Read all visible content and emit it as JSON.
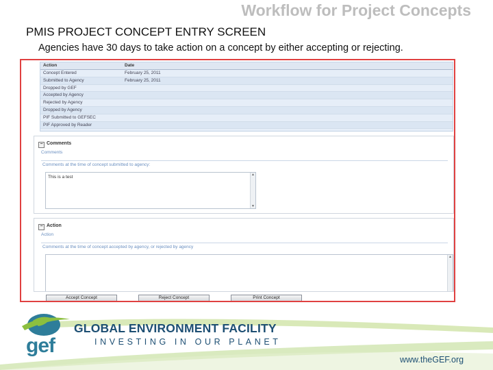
{
  "slide": {
    "title": "Workflow for Project Concepts",
    "screen_title": "PMIS PROJECT CONCEPT ENTRY SCREEN",
    "subtitle": "Agencies have 30 days to take action on a concept by either accepting or rejecting."
  },
  "status_table": {
    "headers": [
      "Action",
      "Date"
    ],
    "rows": [
      {
        "action": "Concept Entered",
        "date": "February 25, 2011"
      },
      {
        "action": "Submitted to Agency",
        "date": "February 25, 2011"
      },
      {
        "action": "Dropped by GEF",
        "date": ""
      },
      {
        "action": "Accepted by Agency",
        "date": ""
      },
      {
        "action": "Rejected by Agency",
        "date": ""
      },
      {
        "action": "Dropped by Agency",
        "date": ""
      },
      {
        "action": "PIF Submitted to GEFSEC",
        "date": ""
      },
      {
        "action": "PIF Approved by Reader",
        "date": ""
      }
    ]
  },
  "comments_panel": {
    "heading": "Comments",
    "legend": "Comments",
    "sublabel": "Comments at the time of concept submitted to agency:",
    "value": "This is a test"
  },
  "action_panel": {
    "heading": "Action",
    "legend": "Action",
    "sublabel": "Comments at the time of concept accepted by agency, or rejected by agency",
    "value": ""
  },
  "buttons": {
    "accept": "Accept Concept",
    "reject": "Reject Concept",
    "print": "Print Concept"
  },
  "footer": {
    "logo_text": "gef",
    "org_name": "GLOBAL ENVIRONMENT FACILITY",
    "tagline": "INVESTING IN OUR PLANET",
    "url": "www.theGEF.org"
  },
  "colors": {
    "title_gray": "#bdbdbd",
    "brand_blue": "#1d4f73",
    "brand_green": "#8cbf3f",
    "frame_red": "#e04040"
  }
}
